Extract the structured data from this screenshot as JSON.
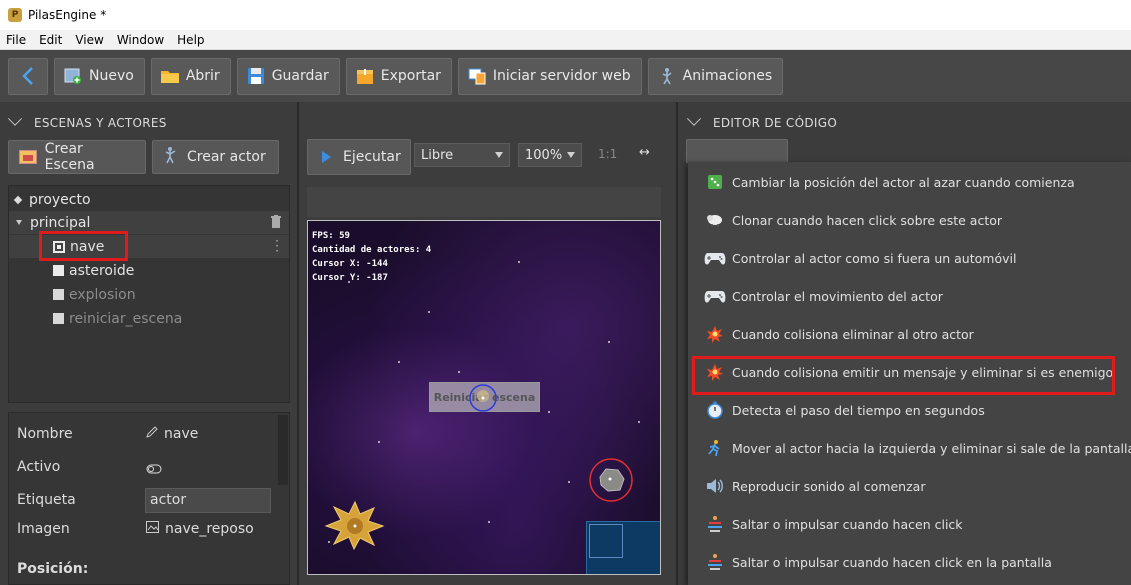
{
  "window": {
    "title": "PilasEngine *"
  },
  "menubar": [
    "File",
    "Edit",
    "View",
    "Window",
    "Help"
  ],
  "toolbar": {
    "nuevo": "Nuevo",
    "abrir": "Abrir",
    "guardar": "Guardar",
    "exportar": "Exportar",
    "servidor": "Iniciar servidor web",
    "animaciones": "Animaciones"
  },
  "left": {
    "section_title": "ESCENAS Y ACTORES",
    "crear_escena": "Crear Escena",
    "crear_actor": "Crear actor",
    "tree": {
      "proyecto": "proyecto",
      "principal": "principal",
      "actors": [
        {
          "name": "nave",
          "selected": true
        },
        {
          "name": "asteroide",
          "selected": false
        },
        {
          "name": "explosion",
          "selected": false
        },
        {
          "name": "reiniciar_escena",
          "selected": false
        }
      ]
    },
    "props": {
      "nombre_label": "Nombre",
      "nombre_value": "nave",
      "activo_label": "Activo",
      "etiqueta_label": "Etiqueta",
      "etiqueta_value": "actor",
      "imagen_label": "Imagen",
      "imagen_value": "nave_reposo",
      "posicion_label": "Posición:"
    }
  },
  "middle": {
    "ejecutar": "Ejecutar",
    "camera_select": "Libre",
    "zoom_select": "100%",
    "ratio": "1:1",
    "expand_icon": "↔",
    "canvas": {
      "fps": "FPS: 59",
      "actores": "Cantidad de actores: 4",
      "cursor_x": "Cursor X: -144",
      "cursor_y": "Cursor Y: -187",
      "reiniciar_label": "Reiniciar escena"
    }
  },
  "right": {
    "section_title": "EDITOR DE CÓDIGO",
    "menu": [
      {
        "label": "Cambiar la posición del actor al azar cuando comienza",
        "icon": "dice-icon"
      },
      {
        "label": "Clonar cuando hacen click sobre este actor",
        "icon": "sheep-icon"
      },
      {
        "label": "Controlar al actor como si fuera un automóvil",
        "icon": "gamepad-icon"
      },
      {
        "label": "Controlar el movimiento del actor",
        "icon": "gamepad-icon"
      },
      {
        "label": "Cuando colisiona eliminar al otro actor",
        "icon": "explosion-icon"
      },
      {
        "label": "Cuando colisiona emitir un mensaje y eliminar si es enemigo",
        "icon": "explosion-icon"
      },
      {
        "label": "Detecta el paso del tiempo en segundos",
        "icon": "stopwatch-icon"
      },
      {
        "label": "Mover al actor hacia la izquierda y eliminar si sale de la pantalla",
        "icon": "runner-icon"
      },
      {
        "label": "Reproducir sonido al comenzar",
        "icon": "speaker-icon"
      },
      {
        "label": "Saltar o impulsar cuando hacen click",
        "icon": "jump-icon"
      },
      {
        "label": "Saltar o impulsar cuando hacen click en la pantalla",
        "icon": "jump-icon"
      }
    ]
  },
  "colors": {
    "highlight": "#e01b1b",
    "accent": "#2f7fd9"
  }
}
